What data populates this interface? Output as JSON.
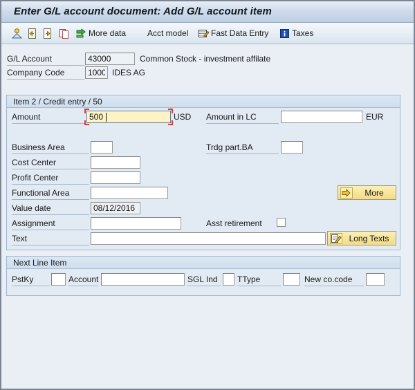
{
  "window": {
    "title": "Enter G/L account document: Add G/L account item"
  },
  "toolbar": {
    "items": [
      {
        "icon": "person-icon",
        "label": ""
      },
      {
        "icon": "previous-item-icon",
        "label": ""
      },
      {
        "icon": "next-item-icon",
        "label": ""
      },
      {
        "icon": "copy-icon",
        "label": ""
      },
      {
        "icon": "more-data-icon",
        "label": "More data"
      },
      {
        "icon": "",
        "label": "Acct model"
      },
      {
        "icon": "fast-data-entry-icon",
        "label": "Fast Data Entry"
      },
      {
        "icon": "taxes-info-icon",
        "label": "Taxes"
      }
    ]
  },
  "header": {
    "gl_account": {
      "label": "G/L Account",
      "value": "43000",
      "description": "Common Stock - investment affilate"
    },
    "company_code": {
      "label": "Company Code",
      "value": "1000",
      "description": "IDES AG"
    }
  },
  "item_panel": {
    "title": "Item 2 / Credit entry / 50",
    "amount": {
      "label": "Amount",
      "value": "500",
      "currency": "USD",
      "focused": true
    },
    "amount_lc": {
      "label": "Amount in LC",
      "value": "",
      "currency": "EUR"
    },
    "business_area": {
      "label": "Business Area",
      "value": ""
    },
    "trdg_part_ba": {
      "label": "Trdg part.BA",
      "value": ""
    },
    "cost_center": {
      "label": "Cost Center",
      "value": ""
    },
    "profit_center": {
      "label": "Profit Center",
      "value": ""
    },
    "functional_area": {
      "label": "Functional Area",
      "value": ""
    },
    "value_date": {
      "label": "Value date",
      "value": "08/12/2016"
    },
    "assignment": {
      "label": "Assignment",
      "value": ""
    },
    "asst_retirement": {
      "label": "Asst retirement",
      "checked": false
    },
    "text": {
      "label": "Text",
      "value": ""
    },
    "more_button": {
      "label": "More",
      "icon": "arrow-right-icon"
    },
    "long_texts_button": {
      "label": "Long Texts",
      "icon": "pencil-note-icon"
    }
  },
  "next_line_item": {
    "title": "Next Line Item",
    "pstky": {
      "label": "PstKy",
      "value": ""
    },
    "account": {
      "label": "Account",
      "value": ""
    },
    "sgl_ind": {
      "label": "SGL Ind",
      "value": ""
    },
    "ttype": {
      "label": "TType",
      "value": ""
    },
    "new_co_code": {
      "label": "New co.code",
      "value": ""
    }
  },
  "colors": {
    "title_bar": "#cfdcec",
    "panel_bg": "#e2eaf3",
    "page_bg": "#eaeff5",
    "focus_fill": "#fdf3c4",
    "focus_marker": "#e03a3a",
    "button_yellow": "#f7e49a"
  }
}
